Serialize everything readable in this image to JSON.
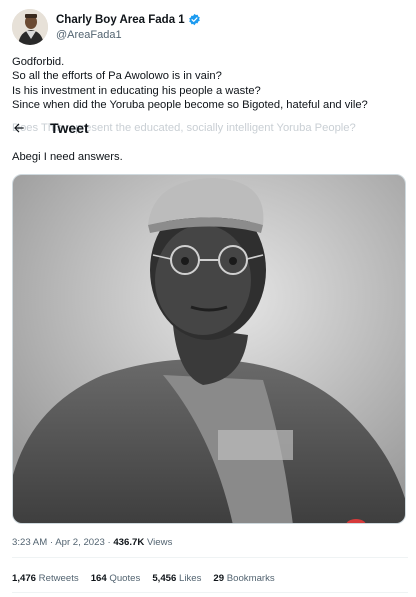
{
  "author": {
    "display_name": "Charly Boy Area Fada 1",
    "handle": "@AreaFada1",
    "avatar_icon": "avatar-photo",
    "verified_icon": "verified-badge-icon",
    "verified_color": "#1d9bf0"
  },
  "header": {
    "back_icon": "arrow-left-icon",
    "title": "Tweet"
  },
  "tweet": {
    "lines": [
      "Godforbid.",
      "So all the efforts of Pa Awolowo is in vain?",
      "Is his investment in educating his people a waste?",
      "Since when did the Yoruba people become so Bigoted, hateful and vile?"
    ],
    "faded_line": "Does This represent the educated, socially intelligent Yoruba People?",
    "last_line": "Abegi I need answers."
  },
  "meta": {
    "time": "3:23 AM",
    "separator": " · ",
    "date": "Apr 2, 2023",
    "views_count": "436.7K",
    "views_label": " Views"
  },
  "stats": {
    "retweets_count": "1,476",
    "retweets_label": " Retweets",
    "quotes_count": "164",
    "quotes_label": " Quotes",
    "likes_count": "5,456",
    "likes_label": " Likes",
    "bookmarks_count": "29",
    "bookmarks_label": " Bookmarks"
  }
}
